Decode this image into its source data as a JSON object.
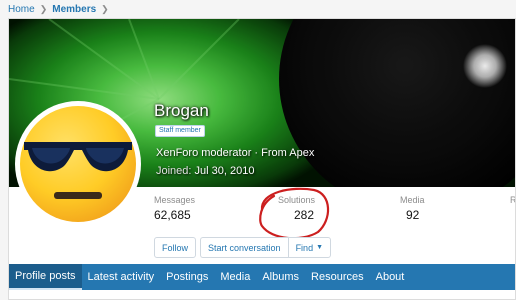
{
  "breadcrumb": {
    "home": "Home",
    "members": "Members"
  },
  "profile": {
    "name": "Brogan",
    "badge": "Staff member",
    "blurb": "XenForo moderator · From Apex",
    "joined_label": "Joined:",
    "joined_value": "Jul 30, 2010",
    "avatar": "sunglasses-emoji"
  },
  "stats": [
    {
      "label": "Messages",
      "value": "62,685"
    },
    {
      "label": "Solutions",
      "value": "282"
    },
    {
      "label": "Media",
      "value": "92"
    },
    {
      "label": "Re",
      "value": ""
    }
  ],
  "actions": {
    "follow": "Follow",
    "start_conversation": "Start conversation",
    "find": "Find"
  },
  "tabs": [
    {
      "label": "Profile posts"
    },
    {
      "label": "Latest activity"
    },
    {
      "label": "Postings"
    },
    {
      "label": "Media"
    },
    {
      "label": "Albums"
    },
    {
      "label": "Resources"
    },
    {
      "label": "About"
    }
  ],
  "colors": {
    "accent": "#2577b1",
    "annotation": "#cc1f1f"
  }
}
